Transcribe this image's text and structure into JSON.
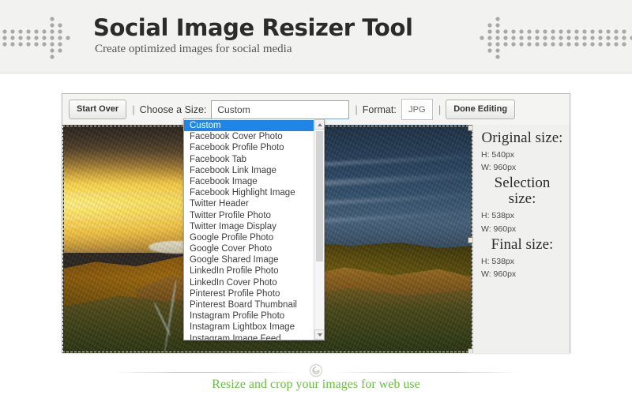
{
  "header": {
    "title": "Social Image Resizer Tool",
    "subtitle": "Create optimized images for social media",
    "left_ornament": "dot-arrow-right-icon",
    "right_ornament": "dot-arrow-left-icon"
  },
  "toolbar": {
    "start_over_label": "Start Over",
    "separator": "|",
    "choose_size_label": "Choose a Size:",
    "size_value": "Custom",
    "format_label": "Format:",
    "format_value": "JPG",
    "done_editing_label": "Done Editing"
  },
  "size_dropdown": {
    "selected": "Custom",
    "options": [
      "Custom",
      "Facebook Cover Photo",
      "Facebook Profile Photo",
      "Facebook Tab",
      "Facebook Link Image",
      "Facebook Image",
      "Facebook Highlight Image",
      "Twitter Header",
      "Twitter Profile Photo",
      "Twitter Image Display",
      "Google Profile Photo",
      "Google Cover Photo",
      "Google Shared Image",
      "LinkedIn Profile Photo",
      "LinkedIn Cover Photo",
      "Pinterest Profile Photo",
      "Pinterest Board Thumbnail",
      "Instagram Profile Photo",
      "Instagram Lightbox Image",
      "Instagram Image Feed"
    ],
    "scroll_up_icon": "triangle-up-icon",
    "scroll_down_icon": "triangle-down-icon"
  },
  "sidebar": {
    "groups": [
      {
        "heading": "Original size:",
        "height": "H: 540px",
        "width": "W: 960px"
      },
      {
        "heading": "Selection size:",
        "height": "H: 538px",
        "width": "W: 960px"
      },
      {
        "heading": "Final size:",
        "height": "H: 538px",
        "width": "W: 960px"
      }
    ]
  },
  "canvas": {
    "image_alt": "landscape-sunset-photo",
    "selection_active": true
  },
  "footer": {
    "ornament": "spiral-ornament-icon",
    "text": "Resize and crop your images for web use",
    "text_color": "#6cbd45"
  },
  "colors": {
    "header_bg": "#f2f2f0",
    "panel_bg": "#f4f4f2",
    "highlight_blue": "#1f86e8",
    "green_accent": "#6cbd45",
    "dot_gray": "#a9a9a6"
  }
}
